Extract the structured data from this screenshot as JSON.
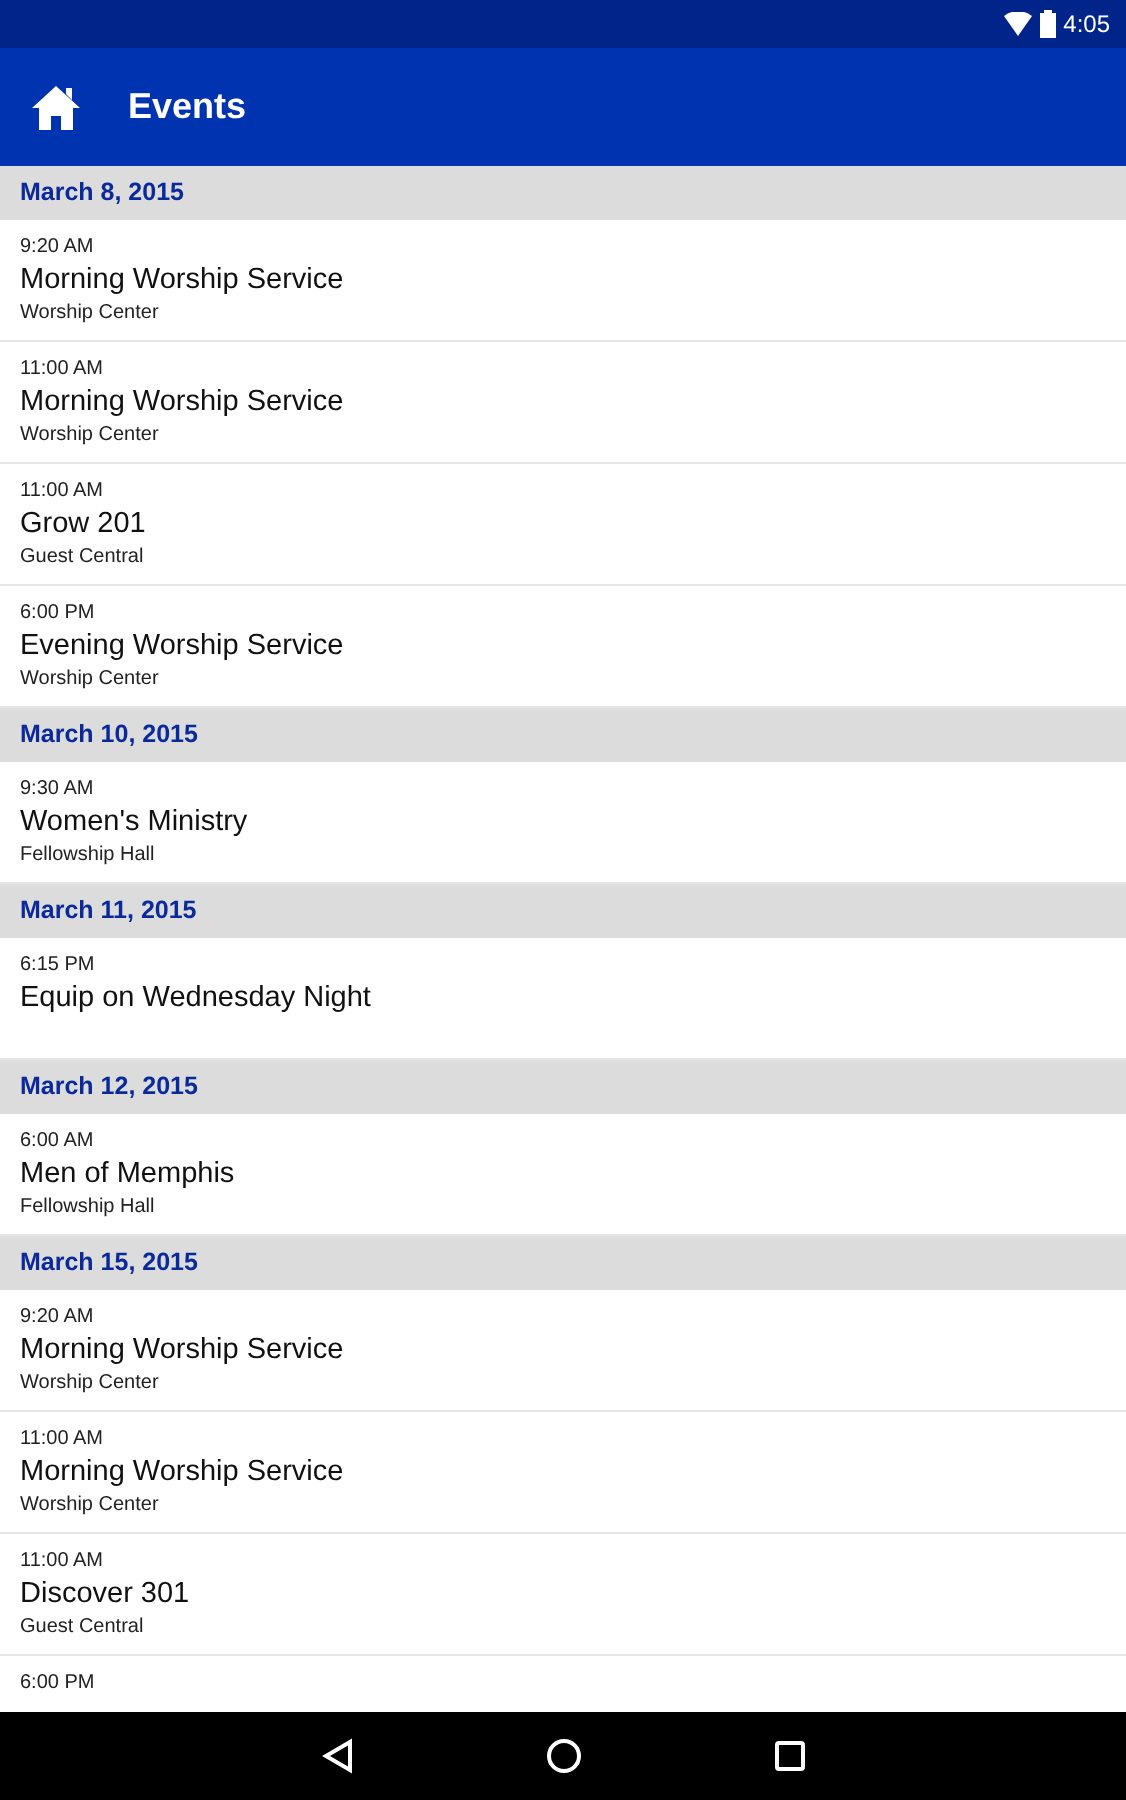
{
  "status_bar": {
    "time": "4:05"
  },
  "app_bar": {
    "title": "Events"
  },
  "sections": [
    {
      "date": "March 8, 2015",
      "events": [
        {
          "time": "9:20 AM",
          "title": "Morning Worship Service",
          "location": "Worship Center"
        },
        {
          "time": "11:00 AM",
          "title": "Morning Worship Service",
          "location": "Worship Center"
        },
        {
          "time": "11:00 AM",
          "title": "Grow 201",
          "location": "Guest Central"
        },
        {
          "time": "6:00 PM",
          "title": "Evening Worship Service",
          "location": "Worship Center"
        }
      ]
    },
    {
      "date": "March 10, 2015",
      "events": [
        {
          "time": "9:30 AM",
          "title": "Women's Ministry",
          "location": "Fellowship Hall"
        }
      ]
    },
    {
      "date": "March 11, 2015",
      "events": [
        {
          "time": "6:15 PM",
          "title": "Equip on Wednesday Night"
        }
      ]
    },
    {
      "date": "March 12, 2015",
      "events": [
        {
          "time": "6:00 AM",
          "title": "Men of Memphis",
          "location": "Fellowship Hall"
        }
      ]
    },
    {
      "date": "March 15, 2015",
      "events": [
        {
          "time": "9:20 AM",
          "title": "Morning Worship Service",
          "location": "Worship Center"
        },
        {
          "time": "11:00 AM",
          "title": "Morning Worship Service",
          "location": "Worship Center"
        },
        {
          "time": "11:00 AM",
          "title": "Discover 301",
          "location": "Guest Central"
        },
        {
          "time": "6:00 PM"
        }
      ]
    }
  ]
}
